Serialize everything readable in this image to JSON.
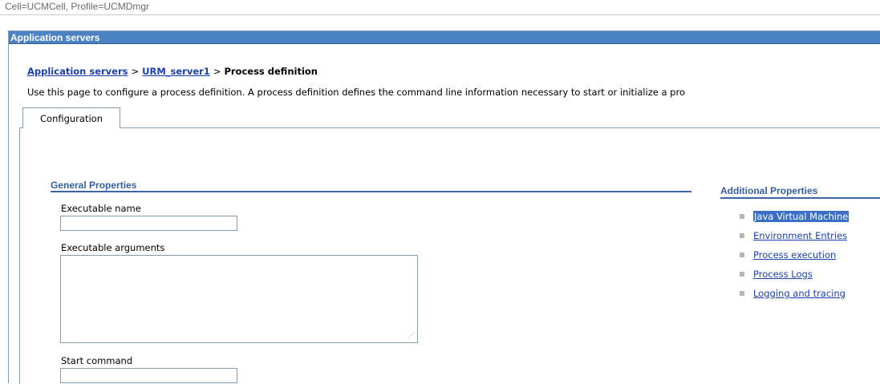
{
  "scope": "Cell=UCMCell, Profile=UCMDmgr",
  "title_bar": "Application servers",
  "breadcrumb": {
    "items": [
      "Application servers",
      "URM_server1"
    ],
    "current": "Process definition",
    "separator": ">"
  },
  "description": "Use this page to configure a process definition. A process definition defines the command line information necessary to start or initialize a pro",
  "tabs": [
    {
      "label": "Configuration",
      "active": true
    }
  ],
  "general_properties": {
    "header": "General Properties",
    "fields": {
      "executable_name": {
        "label": "Executable name",
        "value": ""
      },
      "executable_arguments": {
        "label": "Executable arguments",
        "value": ""
      },
      "start_command": {
        "label": "Start command",
        "value": ""
      }
    }
  },
  "additional_properties": {
    "header": "Additional Properties",
    "links": [
      {
        "label": "Java Virtual Machine",
        "selected": true
      },
      {
        "label": "Environment Entries",
        "selected": false
      },
      {
        "label": "Process execution",
        "selected": false
      },
      {
        "label": "Process Logs",
        "selected": false
      },
      {
        "label": "Logging and tracing",
        "selected": false
      }
    ]
  },
  "colors": {
    "title_bar": "#4b82c3",
    "link": "#1a3fb0",
    "section_header": "#355ea3",
    "selection": "#3a6fc6"
  }
}
